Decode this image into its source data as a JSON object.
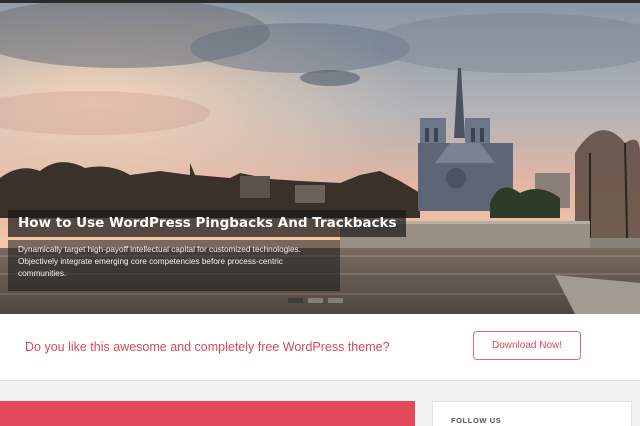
{
  "slider": {
    "title": "How to Use WordPress Pingbacks And Trackbacks",
    "description": "Dynamically target high-payoff intellectual capital for customized technologies. Objectively integrate emerging core competencies before process-centric communities.",
    "slides_total": 3,
    "active_slide": 1
  },
  "cta": {
    "text": "Do you like this awesome and completely free WordPress theme?",
    "button_label": "Download Now!"
  },
  "sidebar": {
    "widget_title": "FOLLOW US"
  },
  "colors": {
    "accent": "#e2495b",
    "cta_text": "#d64a57"
  }
}
